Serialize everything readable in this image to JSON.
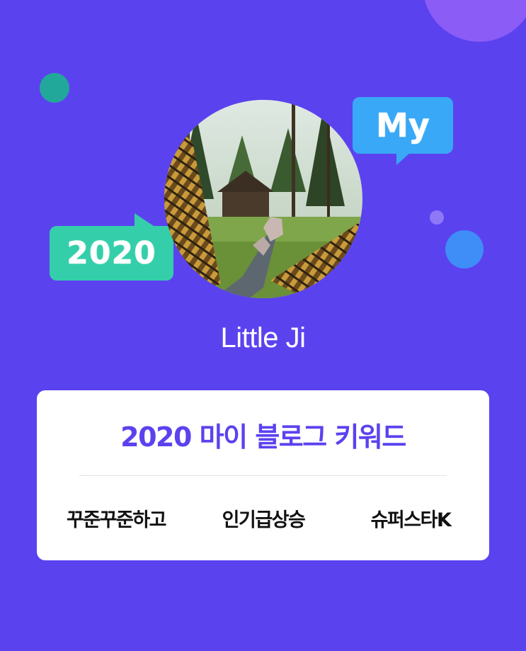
{
  "decorations": {
    "bubble_left_text": "2020",
    "bubble_right_text": "My"
  },
  "profile": {
    "name": "Little Ji"
  },
  "keywords_card": {
    "title": "2020 마이 블로그 키워드",
    "keywords": [
      "꾸준꾸준하고",
      "인기급상승",
      "슈퍼스타K"
    ]
  },
  "colors": {
    "background": "#5b42ef",
    "accent": "#5b42ef",
    "bubble_left": "#34cfaa",
    "bubble_right": "#39a8f6",
    "card": "#ffffff"
  }
}
